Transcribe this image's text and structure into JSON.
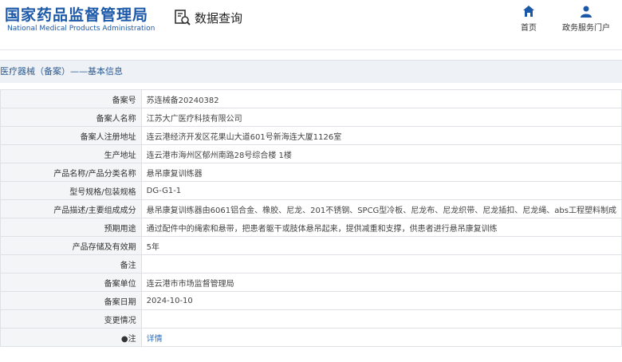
{
  "header": {
    "title_cn": "国家药品监督管理局",
    "title_en": "National Medical Products Administration",
    "query_label": "数据查询",
    "nav": {
      "home": "首页",
      "gov_service": "政务服务门户"
    }
  },
  "breadcrumb": "医疗器械（备案）——基本信息",
  "rows": [
    {
      "label": "备案号",
      "value": "苏连械备20240382"
    },
    {
      "label": "备案人名称",
      "value": "江苏大广医疗科技有限公司"
    },
    {
      "label": "备案人注册地址",
      "value": "连云港经济开发区花果山大道601号新海连大厦1126室"
    },
    {
      "label": "生产地址",
      "value": "连云港市海州区郁州南路28号综合楼 1楼"
    },
    {
      "label": "产品名称/产品分类名称",
      "value": "悬吊康复训练器"
    },
    {
      "label": "型号规格/包装规格",
      "value": "DG-G1-1"
    },
    {
      "label": "产品描述/主要组成成分",
      "value": "悬吊康复训练器由6061铝合金、橡胶、尼龙、201不锈钢、SPCG型冷板、尼龙布、尼龙织带、尼龙插扣、尼龙绳、abs工程塑料制成"
    },
    {
      "label": "预期用途",
      "value": "通过配件中的绳索和悬带，把患者躯干或肢体悬吊起来，提供减重和支撑，供患者进行悬吊康复训练"
    },
    {
      "label": "产品存储及有效期",
      "value": "5年"
    },
    {
      "label": "备注",
      "value": ""
    },
    {
      "label": "备案单位",
      "value": "连云港市市场监督管理局"
    },
    {
      "label": "备案日期",
      "value": "2024-10-10"
    },
    {
      "label": "变更情况",
      "value": ""
    }
  ],
  "note": {
    "label": "●注",
    "link": "详情"
  }
}
